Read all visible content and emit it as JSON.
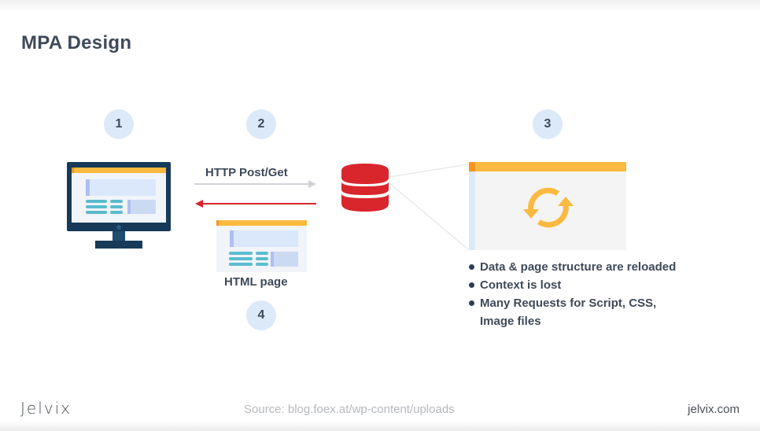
{
  "title": "MPA Design",
  "steps": {
    "one": "1",
    "two": "2",
    "three": "3",
    "four": "4"
  },
  "labels": {
    "request": "HTTP Post/Get",
    "response_page": "HTML page"
  },
  "bullets": [
    "Data & page structure are reloaded",
    "Context is lost",
    "Many Requests for Script, CSS, Image files"
  ],
  "icons": {
    "client": "monitor-icon",
    "server": "database-icon",
    "reload": "refresh-icon"
  },
  "colors": {
    "accent_yellow": "#fbb93f",
    "accent_orange": "#f7941d",
    "database_red": "#d8262c",
    "response_arrow": "#d8262c",
    "request_arrow": "#cfd3d8",
    "monitor_dark": "#163a58",
    "step_bg": "#dce9f8",
    "text_dark": "#3e4a5a"
  },
  "footer": {
    "logo": "Jelvix",
    "source": "Source: blog.foex.at/wp-content/uploads",
    "site": "jelvix.com"
  }
}
